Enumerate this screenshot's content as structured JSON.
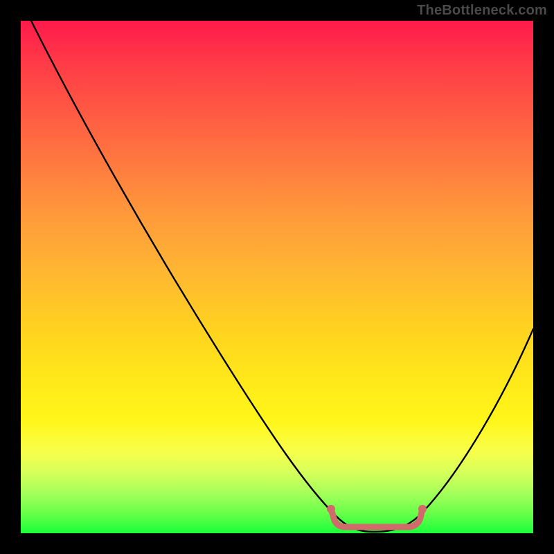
{
  "watermark": "TheBottleneck.com",
  "chart_data": {
    "type": "line",
    "title": "",
    "xlabel": "",
    "ylabel": "",
    "xlim": [
      0,
      100
    ],
    "ylim": [
      0,
      100
    ],
    "grid": false,
    "legend": false,
    "series": [
      {
        "name": "bottleneck-curve",
        "color": "#000000",
        "x": [
          0,
          5,
          10,
          15,
          20,
          25,
          30,
          35,
          40,
          45,
          50,
          55,
          60,
          62,
          65,
          68,
          72,
          76,
          80,
          84,
          88,
          92,
          96,
          100
        ],
        "y": [
          100,
          92,
          84,
          76,
          68,
          60,
          52,
          44,
          36,
          28,
          20,
          13,
          6,
          3,
          1,
          0,
          0,
          1,
          3,
          8,
          15,
          24,
          34,
          45
        ]
      },
      {
        "name": "optimal-range-marker",
        "color": "#d16a6a",
        "x": [
          60,
          80
        ],
        "y": [
          1,
          1
        ]
      }
    ],
    "annotations": [
      {
        "name": "optimal-range",
        "x_start": 60,
        "x_end": 80,
        "note": "bracket indicating optimal (no-bottleneck) region near curve minimum"
      }
    ]
  }
}
